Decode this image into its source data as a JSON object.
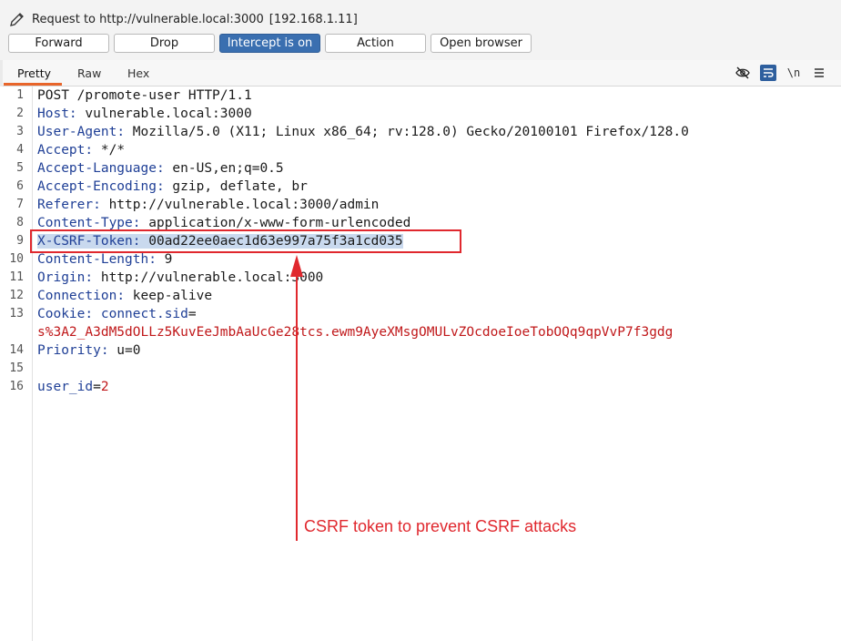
{
  "header": {
    "request_label": "Request to http://vulnerable.local:3000",
    "ip": "[192.168.1.11]",
    "edit_icon": "pencil-icon"
  },
  "buttons": {
    "forward": "Forward",
    "drop": "Drop",
    "intercept": "Intercept is on",
    "action": "Action",
    "open_browser": "Open browser"
  },
  "colors": {
    "intercept_active": "#3a6fb0",
    "tab_accent": "#e8652a",
    "header_key": "#1f3f96",
    "cookie_value": "#c0181a",
    "annotation": "#e0282e"
  },
  "tabs": {
    "pretty": "Pretty",
    "raw": "Raw",
    "hex": "Hex",
    "active": "Pretty"
  },
  "toolbar": {
    "hide_icon": "eye-slash-icon",
    "wrap_icon": "text-wrap-icon",
    "newline_label": "\\n",
    "menu_icon": "hamburger-menu-icon"
  },
  "request": {
    "line_numbers": [
      "1",
      "2",
      "3",
      "4",
      "5",
      "6",
      "7",
      "8",
      "9",
      "10",
      "11",
      "12",
      "13",
      "14",
      "15",
      "16"
    ],
    "request_line": "POST /promote-user HTTP/1.1",
    "headers": [
      {
        "key": "Host",
        "value": " vulnerable.local:3000"
      },
      {
        "key": "User-Agent",
        "value": " Mozilla/5.0 (X11; Linux x86_64; rv:128.0) Gecko/20100101 Firefox/128.0"
      },
      {
        "key": "Accept",
        "value": " */*"
      },
      {
        "key": "Accept-Language",
        "value": " en-US,en;q=0.5"
      },
      {
        "key": "Accept-Encoding",
        "value": " gzip, deflate, br"
      },
      {
        "key": "Referer",
        "value": " http://vulnerable.local:3000/admin"
      },
      {
        "key": "Content-Type",
        "value": " application/x-www-form-urlencoded"
      },
      {
        "key": "X-CSRF-Token",
        "value": " 00ad22ee0aec1d63e997a75f3a1cd035"
      },
      {
        "key": "Content-Length",
        "value": " 9"
      },
      {
        "key": "Origin",
        "value": " http://vulnerable.local:3000"
      },
      {
        "key": "Connection",
        "value": " keep-alive"
      }
    ],
    "cookie_key": "Cookie",
    "cookie_name": "connect.sid",
    "cookie_eq": "=",
    "cookie_value": "s%3A2_A3dM5dOLLz5KuvEeJmbAaUcGe28tcs.ewm9AyeXMsgOMULvZOcdoeIoeTobOQq9qpVvP7f3gdg",
    "priority_key": "Priority",
    "priority_value": " u=0",
    "body_key": "user_id",
    "body_eq": "=",
    "body_value": "2"
  },
  "annotation": {
    "text": "CSRF token to prevent CSRF attacks"
  }
}
